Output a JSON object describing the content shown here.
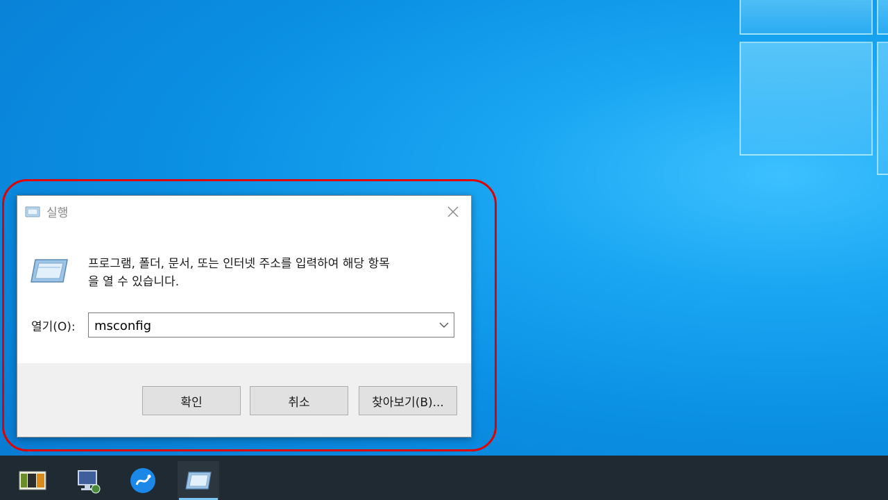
{
  "dialog": {
    "title": "실행",
    "description_line1": "프로그램, 폴더, 문서, 또는 인터넷 주소를 입력하여 해당 항목",
    "description_line2": "을 열 수 있습니다.",
    "open_label": "열기(O):",
    "open_value": "msconfig",
    "ok_label": "확인",
    "cancel_label": "취소",
    "browse_label": "찾아보기(B)..."
  },
  "taskbar": {
    "items": [
      {
        "icon": "hxd-icon"
      },
      {
        "icon": "network-computer-icon"
      },
      {
        "icon": "app-blue-circle-icon"
      },
      {
        "icon": "run-icon"
      }
    ]
  },
  "colors": {
    "highlight": "#e00000",
    "desktop": "#0a8fe3",
    "taskbar": "#1f2a33"
  }
}
